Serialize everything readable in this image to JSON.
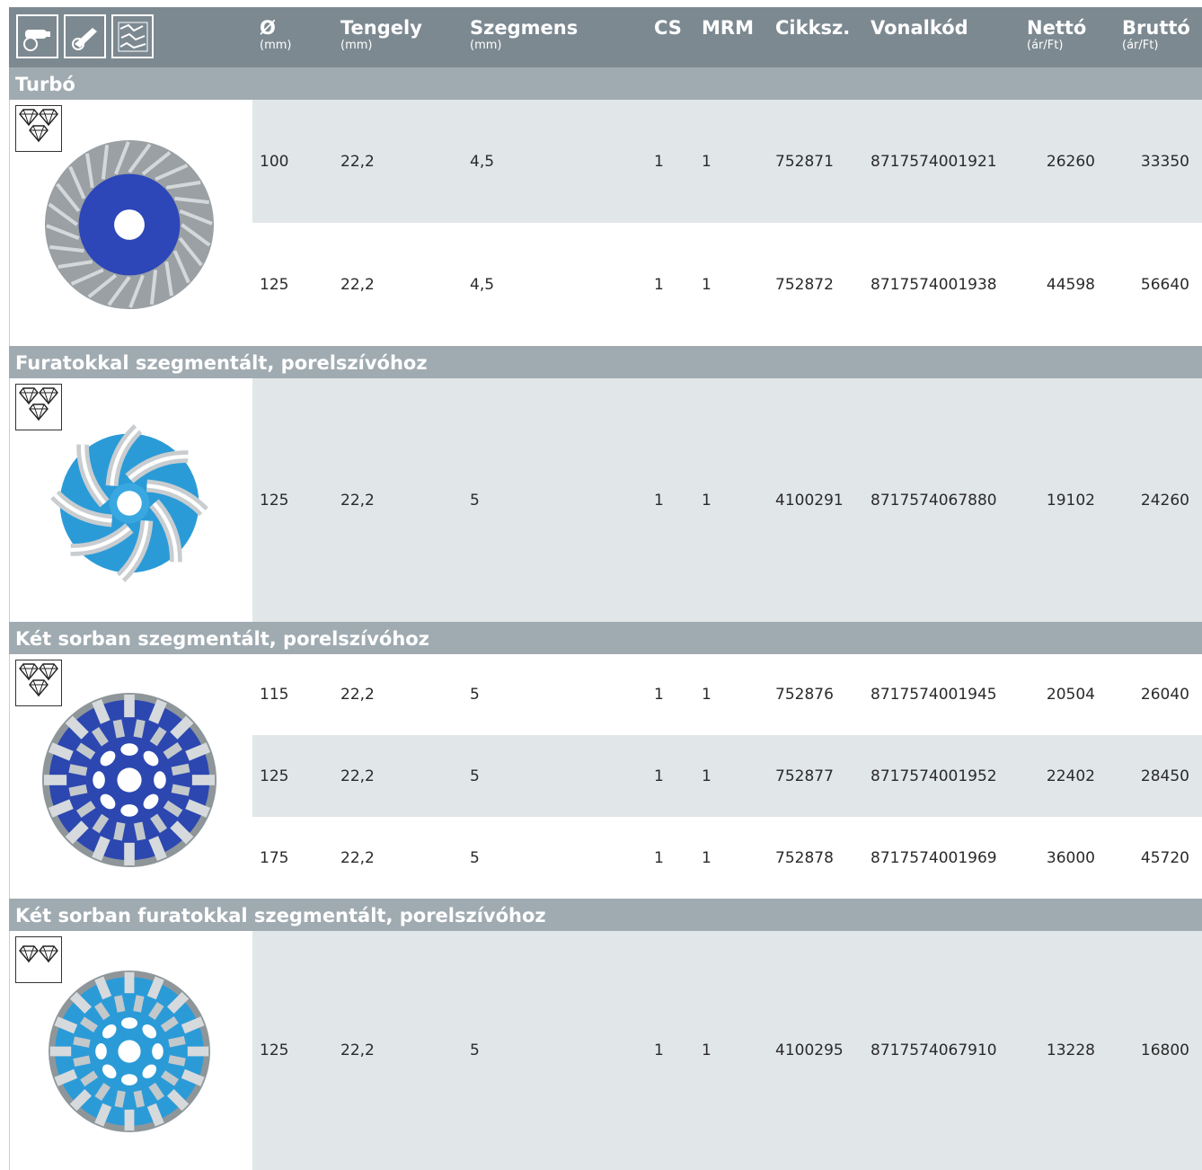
{
  "header": {
    "icons": [
      "angle-grinder-icon",
      "angle-grinder-large-icon",
      "concrete-surface-icon"
    ],
    "columns": [
      {
        "title": "Ø",
        "unit": "(mm)"
      },
      {
        "title": "Tengely",
        "unit": "(mm)"
      },
      {
        "title": "Szegmens",
        "unit": "(mm)"
      },
      {
        "title": "CS",
        "unit": ""
      },
      {
        "title": "MRM",
        "unit": ""
      },
      {
        "title": "Cikksz.",
        "unit": ""
      },
      {
        "title": "Vonalkód",
        "unit": ""
      },
      {
        "title": "Nettó",
        "unit": "(ár/Ft)"
      },
      {
        "title": "Bruttó",
        "unit": "(ár/Ft)"
      }
    ]
  },
  "sections": [
    {
      "title": "Turbó",
      "diamond_count": 3,
      "disc_color": "#2d46b8",
      "rows": [
        {
          "d": "100",
          "arbor": "22,2",
          "seg": "4,5",
          "cs": "1",
          "mrm": "1",
          "sku": "752871",
          "barcode": "8717574001921",
          "net": "26260",
          "gross": "33350"
        },
        {
          "d": "125",
          "arbor": "22,2",
          "seg": "4,5",
          "cs": "1",
          "mrm": "1",
          "sku": "752872",
          "barcode": "8717574001938",
          "net": "44598",
          "gross": "56640"
        }
      ]
    },
    {
      "title": "Furatokkal szegmentált, porelszívóhoz",
      "diamond_count": 3,
      "disc_color": "#2b9bd8",
      "rows": [
        {
          "d": "125",
          "arbor": "22,2",
          "seg": "5",
          "cs": "1",
          "mrm": "1",
          "sku": "4100291",
          "barcode": "8717574067880",
          "net": "19102",
          "gross": "24260"
        }
      ]
    },
    {
      "title": "Két sorban szegmentált, porelszívóhoz",
      "diamond_count": 3,
      "disc_color": "#2c47b0",
      "rows": [
        {
          "d": "115",
          "arbor": "22,2",
          "seg": "5",
          "cs": "1",
          "mrm": "1",
          "sku": "752876",
          "barcode": "8717574001945",
          "net": "20504",
          "gross": "26040"
        },
        {
          "d": "125",
          "arbor": "22,2",
          "seg": "5",
          "cs": "1",
          "mrm": "1",
          "sku": "752877",
          "barcode": "8717574001952",
          "net": "22402",
          "gross": "28450"
        },
        {
          "d": "175",
          "arbor": "22,2",
          "seg": "5",
          "cs": "1",
          "mrm": "1",
          "sku": "752878",
          "barcode": "8717574001969",
          "net": "36000",
          "gross": "45720"
        }
      ]
    },
    {
      "title": "Két sorban furatokkal szegmentált, porelszívóhoz",
      "diamond_count": 2,
      "disc_color": "#2b9bd8",
      "rows": [
        {
          "d": "125",
          "arbor": "22,2",
          "seg": "5",
          "cs": "1",
          "mrm": "1",
          "sku": "4100295",
          "barcode": "8717574067910",
          "net": "13228",
          "gross": "16800"
        }
      ]
    }
  ]
}
